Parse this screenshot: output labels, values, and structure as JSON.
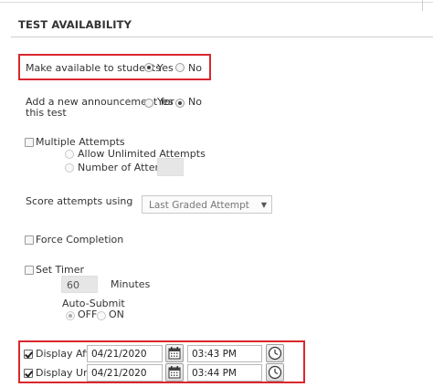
{
  "section": {
    "title": "TEST AVAILABILITY"
  },
  "make_available": {
    "label": "Make available to students",
    "yes": "Yes",
    "no": "No",
    "selected": "Yes"
  },
  "announcement": {
    "label_line1": "Add a new announcement for",
    "label_line2": "this test",
    "yes": "Yes",
    "no": "No",
    "selected": "No"
  },
  "multiple_attempts": {
    "label": "Multiple Attempts",
    "checked": false,
    "allow_unlimited": "Allow Unlimited Attempts",
    "number_of_attempts": "Number of Attempts",
    "number_value": ""
  },
  "score_attempts": {
    "label": "Score attempts using",
    "selected": "Last Graded Attempt"
  },
  "force_completion": {
    "label": "Force Completion",
    "checked": false
  },
  "set_timer": {
    "label": "Set Timer",
    "checked": false,
    "minutes_value": "60",
    "minutes_label": "Minutes",
    "auto_submit_label": "Auto-Submit",
    "off": "OFF",
    "on": "ON",
    "selected": "OFF"
  },
  "display_after": {
    "label": "Display After",
    "checked": true,
    "date": "04/21/2020",
    "time": "03:43 PM"
  },
  "display_until": {
    "label": "Display Until",
    "checked": true,
    "date": "04/21/2020",
    "time": "03:44 PM"
  },
  "colors": {
    "highlight": "#d9272e"
  }
}
